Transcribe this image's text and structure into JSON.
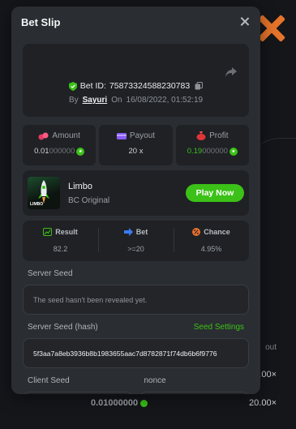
{
  "backdrop": {
    "rows": [
      {
        "amount": "0.01000000",
        "payout": "20.00×"
      }
    ],
    "right_value_1": "20.00×",
    "out_label": "out"
  },
  "modal": {
    "title": "Bet Slip",
    "bet_id_label": "Bet ID:",
    "bet_id": "75873324588230783",
    "by_label": "By",
    "username": "Sayuri",
    "on_label": "On",
    "date": "16/08/2022, 01:52:19"
  },
  "stats": {
    "amount": {
      "label": "Amount",
      "value_main": "0.01",
      "value_dim": "000000"
    },
    "payout": {
      "label": "Payout",
      "value": "20 x"
    },
    "profit": {
      "label": "Profit",
      "value_main": "0.19",
      "value_dim": "000000"
    }
  },
  "game": {
    "name": "Limbo",
    "subtitle": "BC Original",
    "thumb_brand": "LIMBO",
    "play_label": "Play Now"
  },
  "result": {
    "result_label": "Result",
    "result_value": "82.2",
    "bet_label": "Bet",
    "bet_value": ">=20",
    "chance_label": "Chance",
    "chance_value": "4.95%"
  },
  "seeds": {
    "server_seed_label": "Server Seed",
    "server_seed_value": "The seed hasn't been revealed yet.",
    "server_hash_label": "Server Seed (hash)",
    "seed_settings_label": "Seed Settings",
    "server_hash_value": "5f3aa7a8eb3936b8b1983655aac7d8782871f74db6b6f9776",
    "client_seed_label": "Client Seed",
    "nonce_label": "nonce"
  },
  "colors": {
    "accent": "#3bc117",
    "modal_bg": "#2a2d31",
    "card_bg": "#1f2125"
  }
}
